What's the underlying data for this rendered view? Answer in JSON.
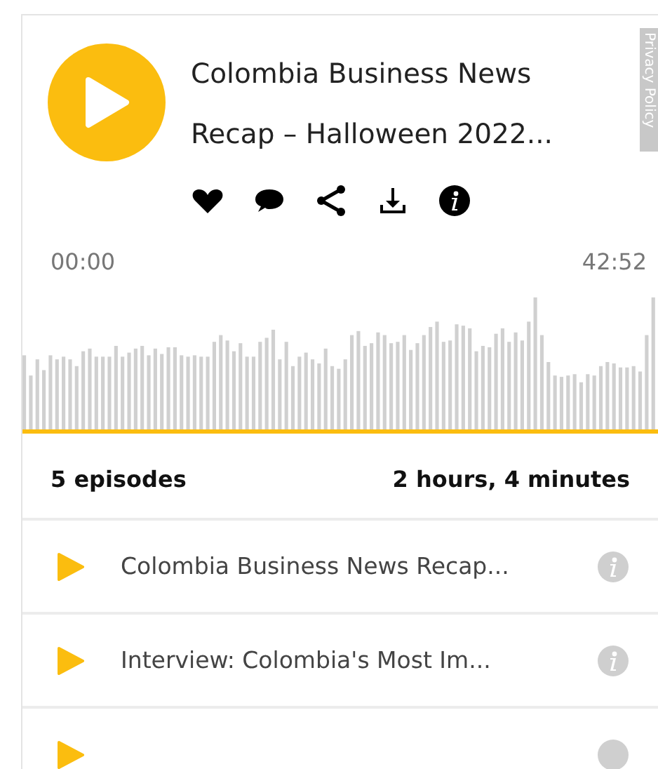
{
  "player": {
    "title_lines": [
      "Colombia Business News",
      "Recap – Halloween 2022..."
    ],
    "elapsed": "00:00",
    "duration": "42:52"
  },
  "privacy_tab": {
    "label": "Privacy Policy"
  },
  "summary": {
    "episodes": "5 episodes",
    "total_time": "2 hours, 4 minutes"
  },
  "episodes": [
    {
      "title": "Colombia Business News Recap..."
    },
    {
      "title": "Interview: Colombia's Most Im..."
    }
  ]
}
